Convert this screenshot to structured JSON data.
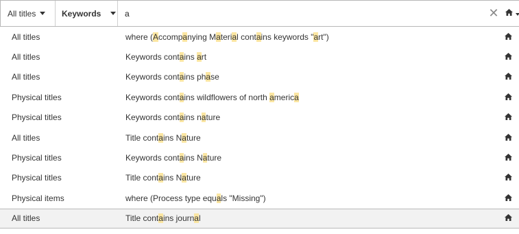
{
  "search": {
    "scope_dropdown": "All titles",
    "field_dropdown": "Keywords",
    "query": "a",
    "clear_icon": "close-icon",
    "home_icon": "home-icon"
  },
  "suggestions": [
    {
      "scope": "All titles",
      "description": "where (Accompanying Material contains keywords \"art\")",
      "parts": [
        [
          "where (",
          0
        ],
        [
          "A",
          1
        ],
        [
          "ccomp",
          0
        ],
        [
          "a",
          1
        ],
        [
          "nying M",
          0
        ],
        [
          "a",
          1
        ],
        [
          "teri",
          0
        ],
        [
          "a",
          1
        ],
        [
          "l cont",
          0
        ],
        [
          "a",
          1
        ],
        [
          "ins keywords \"",
          0
        ],
        [
          "a",
          1
        ],
        [
          "rt\")",
          0
        ]
      ]
    },
    {
      "scope": "All titles",
      "description": "Keywords contains art",
      "parts": [
        [
          "Keywords cont",
          0
        ],
        [
          "a",
          1
        ],
        [
          "ins ",
          0
        ],
        [
          "a",
          1
        ],
        [
          "rt",
          0
        ]
      ]
    },
    {
      "scope": "All titles",
      "description": "Keywords contains phase",
      "parts": [
        [
          "Keywords cont",
          0
        ],
        [
          "a",
          1
        ],
        [
          "ins ph",
          0
        ],
        [
          "a",
          1
        ],
        [
          "se",
          0
        ]
      ]
    },
    {
      "scope": "Physical titles",
      "description": "Keywords contains wildflowers of north america",
      "parts": [
        [
          "Keywords cont",
          0
        ],
        [
          "a",
          1
        ],
        [
          "ins wildflowers of north ",
          0
        ],
        [
          "a",
          1
        ],
        [
          "meric",
          0
        ],
        [
          "a",
          1
        ]
      ]
    },
    {
      "scope": "Physical titles",
      "description": "Keywords contains nature",
      "parts": [
        [
          "Keywords cont",
          0
        ],
        [
          "a",
          1
        ],
        [
          "ins n",
          0
        ],
        [
          "a",
          1
        ],
        [
          "ture",
          0
        ]
      ]
    },
    {
      "scope": "All titles",
      "description": "Title contains Nature",
      "parts": [
        [
          "Title cont",
          0
        ],
        [
          "a",
          1
        ],
        [
          "ins N",
          0
        ],
        [
          "a",
          1
        ],
        [
          "ture",
          0
        ]
      ]
    },
    {
      "scope": "Physical titles",
      "description": "Keywords contains Nature",
      "parts": [
        [
          "Keywords cont",
          0
        ],
        [
          "a",
          1
        ],
        [
          "ins N",
          0
        ],
        [
          "a",
          1
        ],
        [
          "ture",
          0
        ]
      ]
    },
    {
      "scope": "Physical titles",
      "description": "Title contains Nature",
      "parts": [
        [
          "Title cont",
          0
        ],
        [
          "a",
          1
        ],
        [
          "ins N",
          0
        ],
        [
          "a",
          1
        ],
        [
          "ture",
          0
        ]
      ]
    },
    {
      "scope": "Physical items",
      "description": "where (Process type equals \"Missing\")",
      "parts": [
        [
          "where (Process type equ",
          0
        ],
        [
          "a",
          1
        ],
        [
          "ls \"Missing\")",
          0
        ]
      ]
    },
    {
      "scope": "All titles",
      "description": "Title contains journal",
      "selected": true,
      "parts": [
        [
          "Title cont",
          0
        ],
        [
          "a",
          1
        ],
        [
          "ins journ",
          0
        ],
        [
          "a",
          1
        ],
        [
          "l",
          0
        ]
      ]
    }
  ],
  "colors": {
    "highlight": "#fbe6a2",
    "selected_row": "#f2f2f2",
    "text": "#333333"
  }
}
